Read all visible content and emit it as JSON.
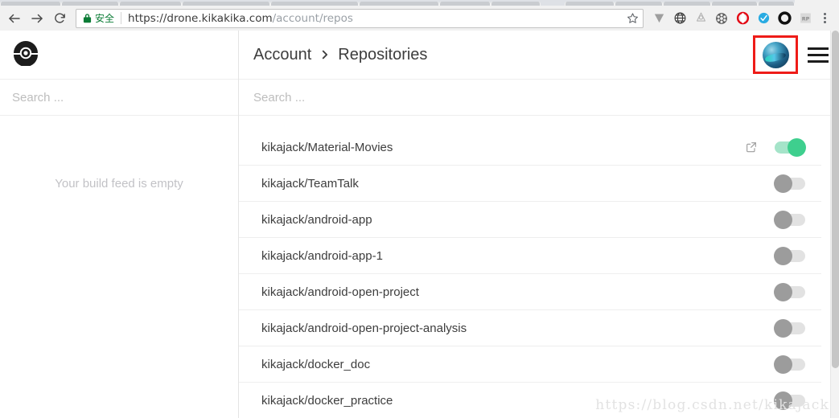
{
  "browser": {
    "back_label": "Back",
    "forward_label": "Forward",
    "reload_label": "Reload",
    "security_badge": "安全",
    "url_scheme_host": "https://drone.kikakika.com",
    "url_path": "/account/repos",
    "bookmark_label": "Bookmark this page",
    "extensions": [
      {
        "name": "v-shape-extension-icon",
        "glyph": "▼"
      },
      {
        "name": "globe-grid-extension-icon",
        "glyph": "◍"
      },
      {
        "name": "bell-outline-extension-icon",
        "glyph": "△"
      },
      {
        "name": "film-reel-extension-icon",
        "glyph": "◉"
      },
      {
        "name": "opera-extension-icon",
        "glyph": "O"
      },
      {
        "name": "blue-check-extension-icon",
        "glyph": "✔"
      },
      {
        "name": "black-ring-extension-icon",
        "glyph": "O"
      },
      {
        "name": "rp-extension-icon",
        "glyph": "RP"
      }
    ],
    "menu_label": "Customize and control Google Chrome"
  },
  "sidebar": {
    "logo_name": "drone-logo",
    "search_placeholder": "Search ...",
    "search_value": "",
    "build_feed_empty": "Your build feed is empty"
  },
  "header": {
    "breadcrumb": [
      {
        "label": "Account"
      },
      {
        "label": "Repositories"
      }
    ],
    "chevron": "›",
    "avatar_label": "User avatar",
    "menu_label": "Menu",
    "highlight_color": "#ee1c18"
  },
  "main": {
    "search_placeholder": "Search ...",
    "search_value": "",
    "toggle_on_color": "#3ecf8e",
    "toggle_off_color": "#9c9c9c",
    "repos": [
      {
        "name": "kikajack/Material-Movies",
        "enabled": true,
        "has_external_link": true
      },
      {
        "name": "kikajack/TeamTalk",
        "enabled": false,
        "has_external_link": false
      },
      {
        "name": "kikajack/android-app",
        "enabled": false,
        "has_external_link": false
      },
      {
        "name": "kikajack/android-app-1",
        "enabled": false,
        "has_external_link": false
      },
      {
        "name": "kikajack/android-open-project",
        "enabled": false,
        "has_external_link": false
      },
      {
        "name": "kikajack/android-open-project-analysis",
        "enabled": false,
        "has_external_link": false
      },
      {
        "name": "kikajack/docker_doc",
        "enabled": false,
        "has_external_link": false
      },
      {
        "name": "kikajack/docker_practice",
        "enabled": false,
        "has_external_link": false
      }
    ]
  },
  "watermark": {
    "text": "https://blog.csdn.net/kikajack"
  }
}
